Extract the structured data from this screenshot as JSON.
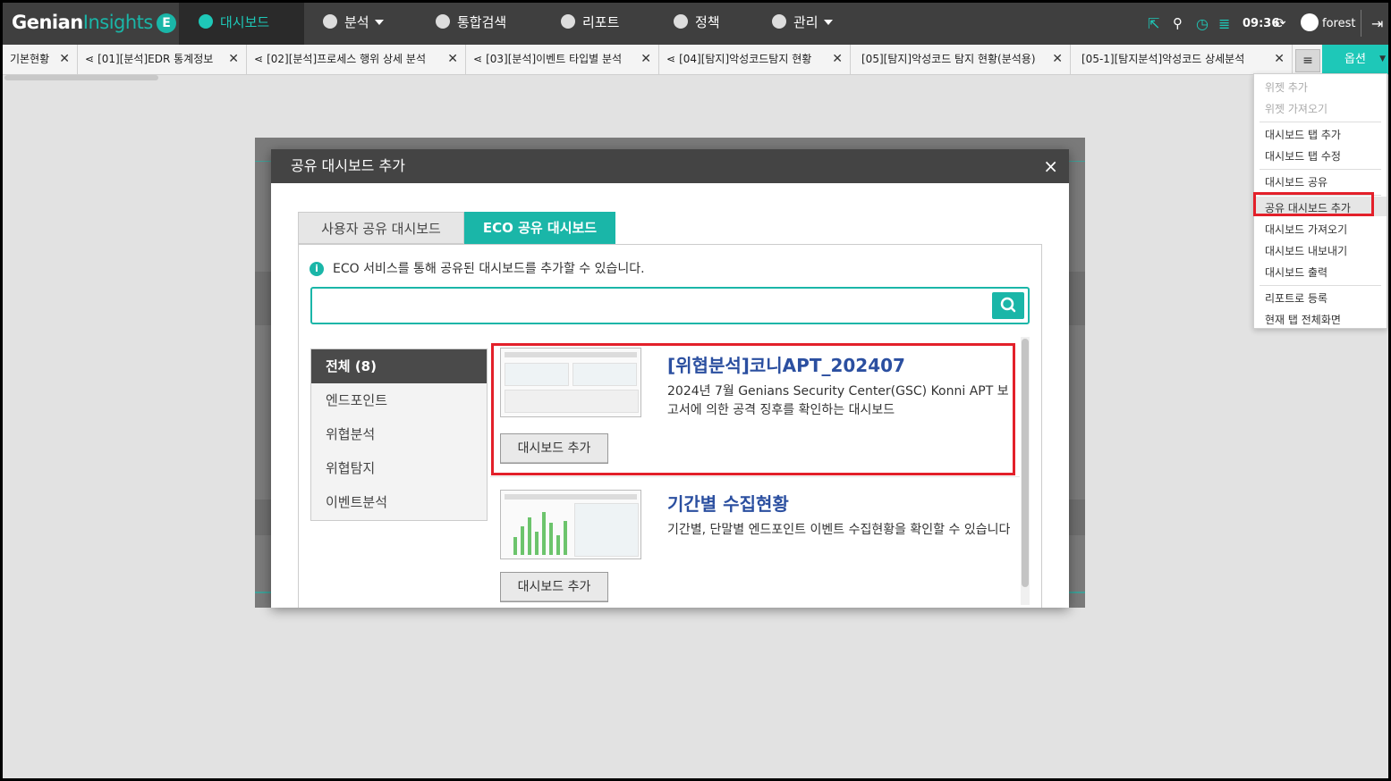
{
  "app": {
    "logo_main": "Genian",
    "logo_sub": "Insights",
    "logo_badge": "E"
  },
  "topnav": [
    {
      "label": "대시보드",
      "icon": "pie-icon",
      "active": true
    },
    {
      "label": "분석",
      "icon": "chart-icon",
      "dropdown": true
    },
    {
      "label": "통합검색",
      "icon": "search-circle-icon"
    },
    {
      "label": "리포트",
      "icon": "report-icon"
    },
    {
      "label": "정책",
      "icon": "policy-icon"
    },
    {
      "label": "관리",
      "icon": "gear-icon",
      "dropdown": true
    }
  ],
  "topright": {
    "time": "09:36",
    "user": "forest"
  },
  "tabs": [
    {
      "label": "기본현황"
    },
    {
      "label": "[01][분석]EDR 통계정보",
      "shared": true
    },
    {
      "label": "[02][분석]프로세스 행위 상세 분석",
      "shared": true
    },
    {
      "label": "[03][분석]이벤트 타입별 분석",
      "shared": true
    },
    {
      "label": "[04][탐지]악성코드탐지 현황",
      "shared": true
    },
    {
      "label": "[05][탐지]악성코드 탐지 현황(분석용)"
    },
    {
      "label": "[05-1][탐지분석]악성코드 상세분석"
    }
  ],
  "options_button": "옵션",
  "options_menu": {
    "items": [
      {
        "label": "위젯 추가",
        "disabled": true
      },
      {
        "label": "위젯 가져오기",
        "disabled": true
      },
      {
        "label": "대시보드 탭 추가"
      },
      {
        "label": "대시보드 탭 수정"
      },
      {
        "label": "대시보드 공유"
      },
      {
        "label": "공유 대시보드 추가",
        "highlighted": true
      },
      {
        "label": "대시보드 가져오기"
      },
      {
        "label": "대시보드 내보내기"
      },
      {
        "label": "대시보드 출력"
      },
      {
        "label": "리포트로 등록"
      },
      {
        "label": "현재 탭 전체화면"
      }
    ]
  },
  "modal": {
    "title": "공유 대시보드 추가",
    "close": "×",
    "tabs": [
      {
        "label": "사용자 공유 대시보드",
        "active": false
      },
      {
        "label": "ECO 공유 대시보드",
        "active": true
      }
    ],
    "info": "ECO 서비스를 통해 공유된 대시보드를 추가할 수 있습니다.",
    "search": {
      "value": "",
      "placeholder": ""
    },
    "categories": [
      {
        "label": "전체 (8)",
        "selected": true
      },
      {
        "label": "엔드포인트"
      },
      {
        "label": "위협분석"
      },
      {
        "label": "위협탐지"
      },
      {
        "label": "이벤트분석"
      }
    ],
    "items": [
      {
        "title": "[위협분석]코니APT_202407",
        "desc": "2024년 7월 Genians Security Center(GSC) Konni APT 보고서에 의한 공격 징후를 확인하는 대시보드",
        "button": "대시보드 추가",
        "highlighted": true
      },
      {
        "title": "기간별 수집현황",
        "desc": "기간별, 단말별 엔드포인트 이벤트 수집현황을 확인할 수 있습니다",
        "button": "대시보드 추가"
      }
    ]
  },
  "colors": {
    "accent": "#1ab6a8",
    "highlight": "#e3202a",
    "nav_bg": "#3f3f3f"
  }
}
